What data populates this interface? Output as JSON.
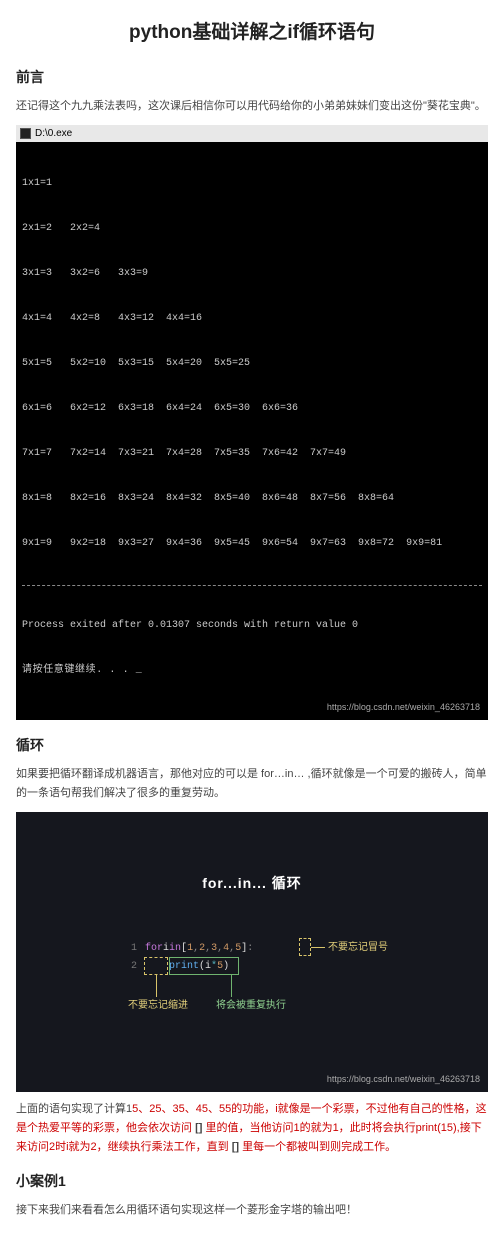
{
  "title": "python基础详解之if循环语句",
  "preface": {
    "heading": "前言",
    "text": "还记得这个九九乘法表吗，这次课后相信你可以用代码给你的小弟弟妹妹们变出这份\"葵花宝典\"。"
  },
  "console": {
    "titlebar": "D:\\0.exe",
    "rows": [
      "1x1=1",
      "2x1=2   2x2=4",
      "3x1=3   3x2=6   3x3=9",
      "4x1=4   4x2=8   4x3=12  4x4=16",
      "5x1=5   5x2=10  5x3=15  5x4=20  5x5=25",
      "6x1=6   6x2=12  6x3=18  6x4=24  6x5=30  6x6=36",
      "7x1=7   7x2=14  7x3=21  7x4=28  7x5=35  7x6=42  7x7=49",
      "8x1=8   8x2=16  8x3=24  8x4=32  8x5=40  8x6=48  8x7=56  8x8=64",
      "9x1=9   9x2=18  9x3=27  9x4=36  9x5=45  9x6=54  9x7=63  9x8=72  9x9=81"
    ],
    "exit_line": "Process exited after 0.01307 seconds with return value 0",
    "prompt_line": "请按任意键继续. . . _",
    "watermark": "https://blog.csdn.net/weixin_46263718"
  },
  "loop": {
    "heading": "循环",
    "text": "如果要把循环翻译成机器语言，那他对应的可以是 for…in… ,循环就像是一个可爱的搬砖人，简单的一条语句帮我们解决了很多的重复劳动。"
  },
  "slide": {
    "title": "for...in... 循环",
    "code": {
      "line1_kw": "for",
      "line1_var": " i ",
      "line1_in": "in",
      "line1_list_open": " [",
      "line1_nums": [
        "1",
        "2",
        "3",
        "4",
        "5"
      ],
      "line1_list_close": "]",
      "line1_colon": ":",
      "line2_fn": "print",
      "line2_open": "(",
      "line2_expr_a": "i",
      "line2_expr_op": "*",
      "line2_expr_b": "5",
      "line2_close": ")"
    },
    "callouts": {
      "top_right": "不要忘记冒号",
      "bottom_left": "不要忘记缩进",
      "bottom_right": "将会被重复执行"
    },
    "watermark": "https://blog.csdn.net/weixin_46263718"
  },
  "after_slide": {
    "text_plain_1": "上面的语句实现了计算1",
    "e1": "5、2",
    "e2": "5、3",
    "e3": "5、4",
    "e4": "5、5",
    "e5": "5的功能，i就像是一个彩票，不过他有自己的性格，这是个热爱平等的彩票，他会依次访问 ",
    "b1": "[]",
    "t2": " 里的值，当他访问1的就为1，此时将会执行print(1",
    "e6": "5),接下来访问2时i就为2，继续执行乘法工作，直到 ",
    "b2": "[]",
    "t3": " 里每一个都被叫到则完成工作。"
  },
  "case1": {
    "heading": "小案例1",
    "text": "接下来我们来看看怎么用循环语句实现这样一个菱形金字塔的输出吧！"
  },
  "chart_data": {
    "type": "table",
    "title": "九九乘法表 (9x9 multiplication table, lower triangle)",
    "rows": [
      [
        1
      ],
      [
        2,
        4
      ],
      [
        3,
        6,
        9
      ],
      [
        4,
        8,
        12,
        16
      ],
      [
        5,
        10,
        15,
        20,
        25
      ],
      [
        6,
        12,
        18,
        24,
        30,
        36
      ],
      [
        7,
        14,
        21,
        28,
        35,
        42,
        49
      ],
      [
        8,
        16,
        24,
        32,
        40,
        48,
        56,
        64
      ],
      [
        9,
        18,
        27,
        36,
        45,
        54,
        63,
        72,
        81
      ]
    ]
  }
}
